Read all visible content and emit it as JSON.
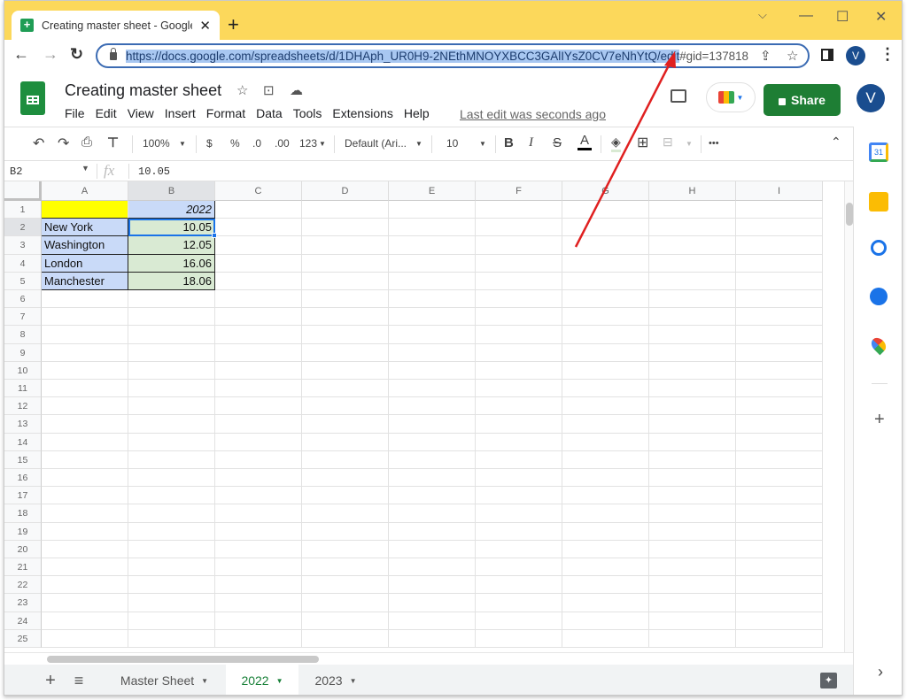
{
  "browser": {
    "tab_title": "Creating master sheet - Google S",
    "new_tab": "+",
    "controls": {
      "menu": "⌵",
      "minimize": "—",
      "maximize": "☐",
      "close": "✕"
    },
    "url_selected": "https://docs.google.com/spreadsheets/d/1DHAph_UR0H9-2NEthMNOYXBCC3GAlIYsZ0CV7eNhYtQ/edit",
    "url_rest": "#gid=137818",
    "profile_initial": "V",
    "nav": {
      "back": "←",
      "forward": "→",
      "reload": "↻"
    }
  },
  "app": {
    "doc_title": "Creating master sheet",
    "menu": [
      "File",
      "Edit",
      "View",
      "Insert",
      "Format",
      "Data",
      "Tools",
      "Extensions",
      "Help"
    ],
    "last_edit": "Last edit was seconds ago",
    "share_label": "Share",
    "account_initial": "V"
  },
  "toolbar": {
    "zoom": "100%",
    "currency": "$",
    "percent": "%",
    "dec_decrease": ".0",
    "dec_increase": ".00",
    "more_formats": "123",
    "font": "Default (Ari...",
    "font_size": "10",
    "bold": "B",
    "italic": "I",
    "strike": "S",
    "text_color": "A",
    "more": "•••"
  },
  "formula_bar": {
    "name_box": "B2",
    "fx": "fx",
    "value": "10.05"
  },
  "grid": {
    "columns": [
      "A",
      "B",
      "C",
      "D",
      "E",
      "F",
      "G",
      "H",
      "I"
    ],
    "rows": [
      "1",
      "2",
      "3",
      "4",
      "5",
      "6",
      "7",
      "8",
      "9",
      "10",
      "11",
      "12",
      "13",
      "14",
      "15",
      "16",
      "17",
      "18",
      "19",
      "20",
      "21",
      "22",
      "23",
      "24",
      "25"
    ],
    "cells": {
      "A1": "",
      "B1": "2022",
      "A2": "New York",
      "B2": "10.05",
      "A3": "Washington",
      "B3": "12.05",
      "A4": "London",
      "B4": "16.06",
      "A5": "Manchester",
      "B5": "18.06"
    },
    "selected_cell": "B2",
    "colors": {
      "header_fill": "#ffff00",
      "city_fill": "#c9daf8",
      "value_fill": "#d9ead3",
      "year_fill": "#c9daf8",
      "selection": "#1a73e8"
    }
  },
  "sheets": {
    "add": "+",
    "list": "≡",
    "tabs": [
      {
        "label": "Master Sheet",
        "active": false
      },
      {
        "label": "2022",
        "active": true
      },
      {
        "label": "2023",
        "active": false
      }
    ]
  },
  "side_panel": {
    "items": [
      "calendar",
      "keep",
      "tasks",
      "contacts",
      "maps"
    ],
    "calendar_day": "31",
    "add": "+",
    "expand": "›"
  },
  "annotation": {
    "color": "#e02020",
    "target": "edit"
  }
}
